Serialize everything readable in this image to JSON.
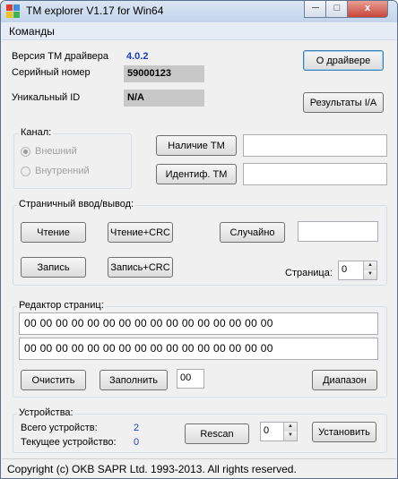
{
  "window": {
    "title": "TM explorer V1.17 for Win64",
    "controls": {
      "minimize": "─",
      "maximize": "□",
      "close": "x"
    }
  },
  "menu": {
    "commands": "Команды"
  },
  "info": {
    "driver_version_label": "Версия  TM драйвера",
    "driver_version_value": "4.0.2",
    "serial_label": "Серийный номер",
    "serial_value": "59000123",
    "unique_id_label": "Уникальный ID",
    "unique_id_value": "N/A",
    "about_button": "О драйвере",
    "results_button": "Результаты I/A"
  },
  "channel": {
    "title": "Канал:",
    "external": "Внешний",
    "internal": "Внутренний",
    "presence_button": "Наличие ТМ",
    "presence_value": "",
    "identify_button": "Идентиф. ТМ",
    "identify_value": ""
  },
  "page_io": {
    "title": "Страничный ввод/вывод:",
    "read": "Чтение",
    "read_crc": "Чтение+CRC",
    "random": "Случайно",
    "random_value": "",
    "write": "Запись",
    "write_crc": "Запись+CRC",
    "page_label": "Страница:",
    "page_value": "0"
  },
  "editor": {
    "title": "Редактор страниц:",
    "line1": "00  00  00  00  00  00  00  00  00  00  00  00  00  00  00  00",
    "line2": "00  00  00  00  00  00  00  00  00  00  00  00  00  00  00  00",
    "clear": "Очистить",
    "fill": "Заполнить",
    "fill_value": "00",
    "range": "Диапазон"
  },
  "devices": {
    "title": "Устройства:",
    "total_label": "Всего устройств:",
    "total_value": "2",
    "current_label": "Текущее устройство:",
    "current_value": "0",
    "rescan": "Rescan",
    "spin_value": "0",
    "set": "Установить"
  },
  "status": {
    "copyright": "Copyright (c) OKB SAPR Ltd. 1993-2013. All rights reserved."
  }
}
